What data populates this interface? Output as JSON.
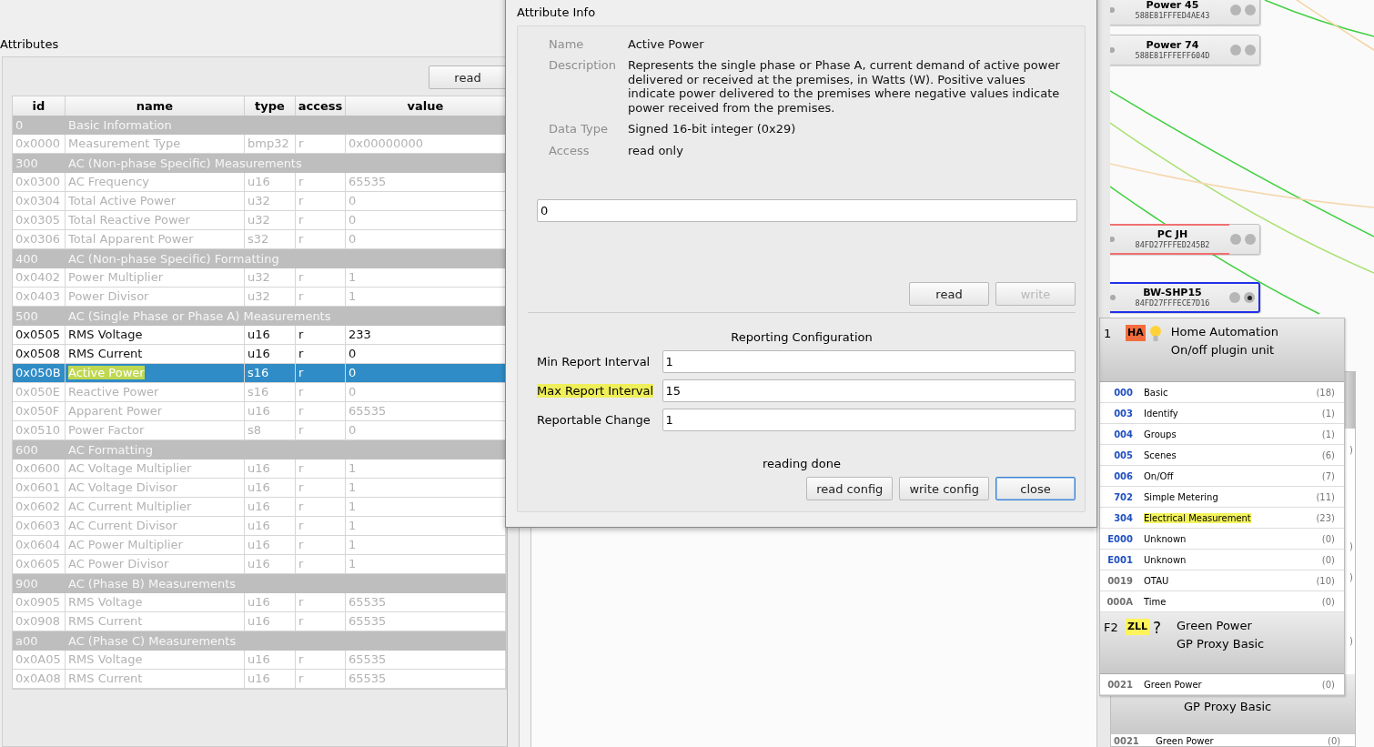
{
  "attributes_panel": {
    "title": "Attributes",
    "read_button": "read",
    "table": {
      "columns": [
        "id",
        "name",
        "type",
        "access",
        "value"
      ],
      "rows": [
        {
          "kind": "group",
          "id": "0",
          "name": "Basic Information"
        },
        {
          "kind": "attribute",
          "id": "0x0000",
          "name": "Measurement Type",
          "type": "bmp32",
          "access": "r",
          "value": "0x00000000",
          "enabled": false,
          "selected": false,
          "marked": false
        },
        {
          "kind": "group",
          "id": "300",
          "name": "AC (Non-phase Specific) Measurements"
        },
        {
          "kind": "attribute",
          "id": "0x0300",
          "name": "AC Frequency",
          "type": "u16",
          "access": "r",
          "value": "65535",
          "enabled": false,
          "selected": false,
          "marked": false
        },
        {
          "kind": "attribute",
          "id": "0x0304",
          "name": "Total Active Power",
          "type": "u32",
          "access": "r",
          "value": "0",
          "enabled": false,
          "selected": false,
          "marked": false
        },
        {
          "kind": "attribute",
          "id": "0x0305",
          "name": "Total Reactive Power",
          "type": "u32",
          "access": "r",
          "value": "0",
          "enabled": false,
          "selected": false,
          "marked": false
        },
        {
          "kind": "attribute",
          "id": "0x0306",
          "name": "Total Apparent Power",
          "type": "s32",
          "access": "r",
          "value": "0",
          "enabled": false,
          "selected": false,
          "marked": false
        },
        {
          "kind": "group",
          "id": "400",
          "name": "AC (Non-phase Specific) Formatting"
        },
        {
          "kind": "attribute",
          "id": "0x0402",
          "name": "Power Multiplier",
          "type": "u32",
          "access": "r",
          "value": "1",
          "enabled": false,
          "selected": false,
          "marked": false
        },
        {
          "kind": "attribute",
          "id": "0x0403",
          "name": "Power Divisor",
          "type": "u32",
          "access": "r",
          "value": "1",
          "enabled": false,
          "selected": false,
          "marked": false
        },
        {
          "kind": "group",
          "id": "500",
          "name": "AC (Single Phase or Phase A) Measurements"
        },
        {
          "kind": "attribute",
          "id": "0x0505",
          "name": "RMS Voltage",
          "type": "u16",
          "access": "r",
          "value": "233",
          "enabled": true,
          "selected": false,
          "marked": false
        },
        {
          "kind": "attribute",
          "id": "0x0508",
          "name": "RMS Current",
          "type": "u16",
          "access": "r",
          "value": "0",
          "enabled": true,
          "selected": false,
          "marked": false
        },
        {
          "kind": "attribute",
          "id": "0x050B",
          "name": "Active Power",
          "type": "s16",
          "access": "r",
          "value": "0",
          "enabled": true,
          "selected": true,
          "marked": true
        },
        {
          "kind": "attribute",
          "id": "0x050E",
          "name": "Reactive Power",
          "type": "s16",
          "access": "r",
          "value": "0",
          "enabled": false,
          "selected": false,
          "marked": false
        },
        {
          "kind": "attribute",
          "id": "0x050F",
          "name": "Apparent Power",
          "type": "u16",
          "access": "r",
          "value": "65535",
          "enabled": false,
          "selected": false,
          "marked": false
        },
        {
          "kind": "attribute",
          "id": "0x0510",
          "name": "Power Factor",
          "type": "s8",
          "access": "r",
          "value": "0",
          "enabled": false,
          "selected": false,
          "marked": false
        },
        {
          "kind": "group",
          "id": "600",
          "name": "AC Formatting"
        },
        {
          "kind": "attribute",
          "id": "0x0600",
          "name": "AC Voltage Multiplier",
          "type": "u16",
          "access": "r",
          "value": "1",
          "enabled": false,
          "selected": false,
          "marked": false
        },
        {
          "kind": "attribute",
          "id": "0x0601",
          "name": "AC Voltage Divisor",
          "type": "u16",
          "access": "r",
          "value": "1",
          "enabled": false,
          "selected": false,
          "marked": false
        },
        {
          "kind": "attribute",
          "id": "0x0602",
          "name": "AC Current Multiplier",
          "type": "u16",
          "access": "r",
          "value": "1",
          "enabled": false,
          "selected": false,
          "marked": false
        },
        {
          "kind": "attribute",
          "id": "0x0603",
          "name": "AC Current Divisor",
          "type": "u16",
          "access": "r",
          "value": "1",
          "enabled": false,
          "selected": false,
          "marked": false
        },
        {
          "kind": "attribute",
          "id": "0x0604",
          "name": "AC Power Multiplier",
          "type": "u16",
          "access": "r",
          "value": "1",
          "enabled": false,
          "selected": false,
          "marked": false
        },
        {
          "kind": "attribute",
          "id": "0x0605",
          "name": "AC Power Divisor",
          "type": "u16",
          "access": "r",
          "value": "1",
          "enabled": false,
          "selected": false,
          "marked": false
        },
        {
          "kind": "group",
          "id": "900",
          "name": "AC (Phase B) Measurements"
        },
        {
          "kind": "attribute",
          "id": "0x0905",
          "name": "RMS Voltage",
          "type": "u16",
          "access": "r",
          "value": "65535",
          "enabled": false,
          "selected": false,
          "marked": false
        },
        {
          "kind": "attribute",
          "id": "0x0908",
          "name": "RMS Current",
          "type": "u16",
          "access": "r",
          "value": "65535",
          "enabled": false,
          "selected": false,
          "marked": false
        },
        {
          "kind": "group",
          "id": "a00",
          "name": "AC (Phase C) Measurements"
        },
        {
          "kind": "attribute",
          "id": "0x0A05",
          "name": "RMS Voltage",
          "type": "u16",
          "access": "r",
          "value": "65535",
          "enabled": false,
          "selected": false,
          "marked": false
        },
        {
          "kind": "attribute",
          "id": "0x0A08",
          "name": "RMS Current",
          "type": "u16",
          "access": "r",
          "value": "65535",
          "enabled": false,
          "selected": false,
          "marked": false
        }
      ]
    }
  },
  "dialog": {
    "section_title": "Attribute Info",
    "info": [
      {
        "label": "Name",
        "value": "Active Power"
      },
      {
        "label": "Description",
        "value": "Represents the single phase or Phase A, current demand of active power delivered or received at the premises, in Watts (W). Positive values indicate power delivered to the premises where negative values indicate power received from the premises."
      },
      {
        "label": "Data Type",
        "value": "Signed 16-bit integer (0x29)"
      },
      {
        "label": "Access",
        "value": "read only"
      }
    ],
    "value_field": "0",
    "value_buttons": [
      {
        "label": "read",
        "disabled": false
      },
      {
        "label": "write",
        "disabled": true
      }
    ],
    "reporting_title": "Reporting Configuration",
    "reporting_fields": [
      {
        "label": "Min Report Interval",
        "value": "1",
        "marked": false
      },
      {
        "label": "Max Report Interval",
        "value": "15",
        "marked": true
      },
      {
        "label": "Reportable Change",
        "value": "1",
        "marked": false
      }
    ],
    "status": "reading done",
    "buttons": [
      {
        "label": "read config",
        "focused": false
      },
      {
        "label": "write config",
        "focused": false
      },
      {
        "label": "close",
        "focused": true
      }
    ]
  },
  "canvas": {
    "nodes": [
      {
        "name": "Power 45",
        "address": "588E81FFFED4AE43",
        "selected": false,
        "alert": false
      },
      {
        "name": "Power 74",
        "address": "588E81FFFEFF604D",
        "selected": false,
        "alert": false
      },
      {
        "name": "PC JH",
        "address": "84FD27FFFED245B2",
        "selected": false,
        "alert": true
      },
      {
        "name": "BW-SHP15",
        "address": "84FD27FFFECE7D16",
        "selected": true,
        "alert": false
      }
    ],
    "endpoints": [
      {
        "id": "1",
        "badge": "HA",
        "color": "#f26d3d",
        "kind": "bulb",
        "title": "Home Automation",
        "subtitle": "On/off plugin unit",
        "clusters": [
          {
            "id": "000",
            "name": "Basic",
            "count": "(18)",
            "color": "#2050c0",
            "marked": false
          },
          {
            "id": "003",
            "name": "Identify",
            "count": "(1)",
            "color": "#2050c0",
            "marked": false
          },
          {
            "id": "004",
            "name": "Groups",
            "count": "(1)",
            "color": "#2050c0",
            "marked": false
          },
          {
            "id": "005",
            "name": "Scenes",
            "count": "(6)",
            "color": "#2050c0",
            "marked": false
          },
          {
            "id": "006",
            "name": "On/Off",
            "count": "(7)",
            "color": "#2050c0",
            "marked": false
          },
          {
            "id": "702",
            "name": "Simple Metering",
            "count": "(11)",
            "color": "#2050c0",
            "marked": false
          },
          {
            "id": "304",
            "name": "Electrical Measurement",
            "count": "(23)",
            "color": "#2050c0",
            "marked": true
          },
          {
            "id": "E000",
            "name": "Unknown",
            "count": "(0)",
            "color": "#2050c0",
            "marked": false
          },
          {
            "id": "E001",
            "name": "Unknown",
            "count": "(0)",
            "color": "#2050c0",
            "marked": false
          },
          {
            "id": "0019",
            "name": "OTAU",
            "count": "(10)",
            "color": "#707070",
            "marked": false
          },
          {
            "id": "000A",
            "name": "Time",
            "count": "(0)",
            "color": "#707070",
            "marked": false
          }
        ]
      },
      {
        "id": "F2",
        "badge": "ZLL",
        "color": "#fff35c",
        "kind": "text",
        "symbol": "?",
        "title": "Green Power",
        "subtitle": "GP Proxy Basic",
        "clusters": [
          {
            "id": "0021",
            "name": "Green Power",
            "count": "(0)",
            "color": "#707070",
            "marked": false
          }
        ]
      }
    ],
    "rear_panel": {
      "fragments": [
        ")",
        ")",
        ")",
        ")"
      ],
      "subtitle": "GP Proxy Basic",
      "cluster": {
        "id": "0021",
        "name": "Green Power",
        "count": "(0)"
      }
    }
  }
}
